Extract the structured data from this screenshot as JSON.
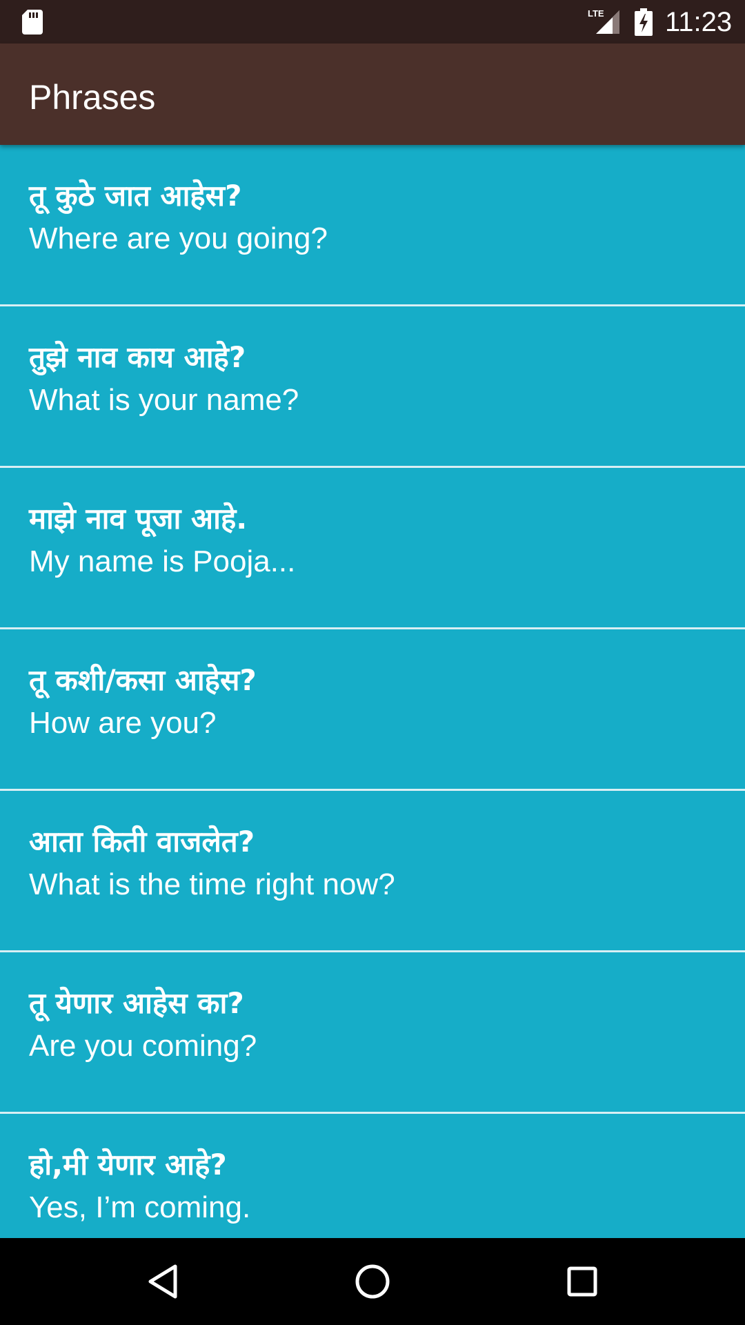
{
  "status_bar": {
    "time": "11:23",
    "network_label": "LTE",
    "icons": [
      "sd-card-icon",
      "lte-signal-icon",
      "battery-charging-icon"
    ]
  },
  "app_bar": {
    "title": "Phrases"
  },
  "phrases": [
    {
      "marathi": "तू कुठे जात आहेस?",
      "english": "Where are you going?"
    },
    {
      "marathi": "तुझे नाव काय आहे?",
      "english": "What is your name?"
    },
    {
      "marathi": "माझे नाव पूजा आहे.",
      "english": "My name is Pooja..."
    },
    {
      "marathi": "तू कशी/कसा आहेस?",
      "english": "How are you?"
    },
    {
      "marathi": "आता किती वाजलेत?",
      "english": "What is the time right now?"
    },
    {
      "marathi": "तू येणार आहेस का?",
      "english": "Are you coming?"
    },
    {
      "marathi": "हो,मी येणार आहे?",
      "english": "Yes, I’m coming."
    }
  ],
  "nav_bar": {
    "buttons": [
      "back-icon",
      "home-icon",
      "recents-icon"
    ]
  },
  "colors": {
    "status_bar": "#2F1E1C",
    "app_bar": "#4B302A",
    "list_background": "#16ADC8",
    "divider": "#D8EFF4",
    "text": "#FFFFFF",
    "nav_bar": "#000000"
  }
}
